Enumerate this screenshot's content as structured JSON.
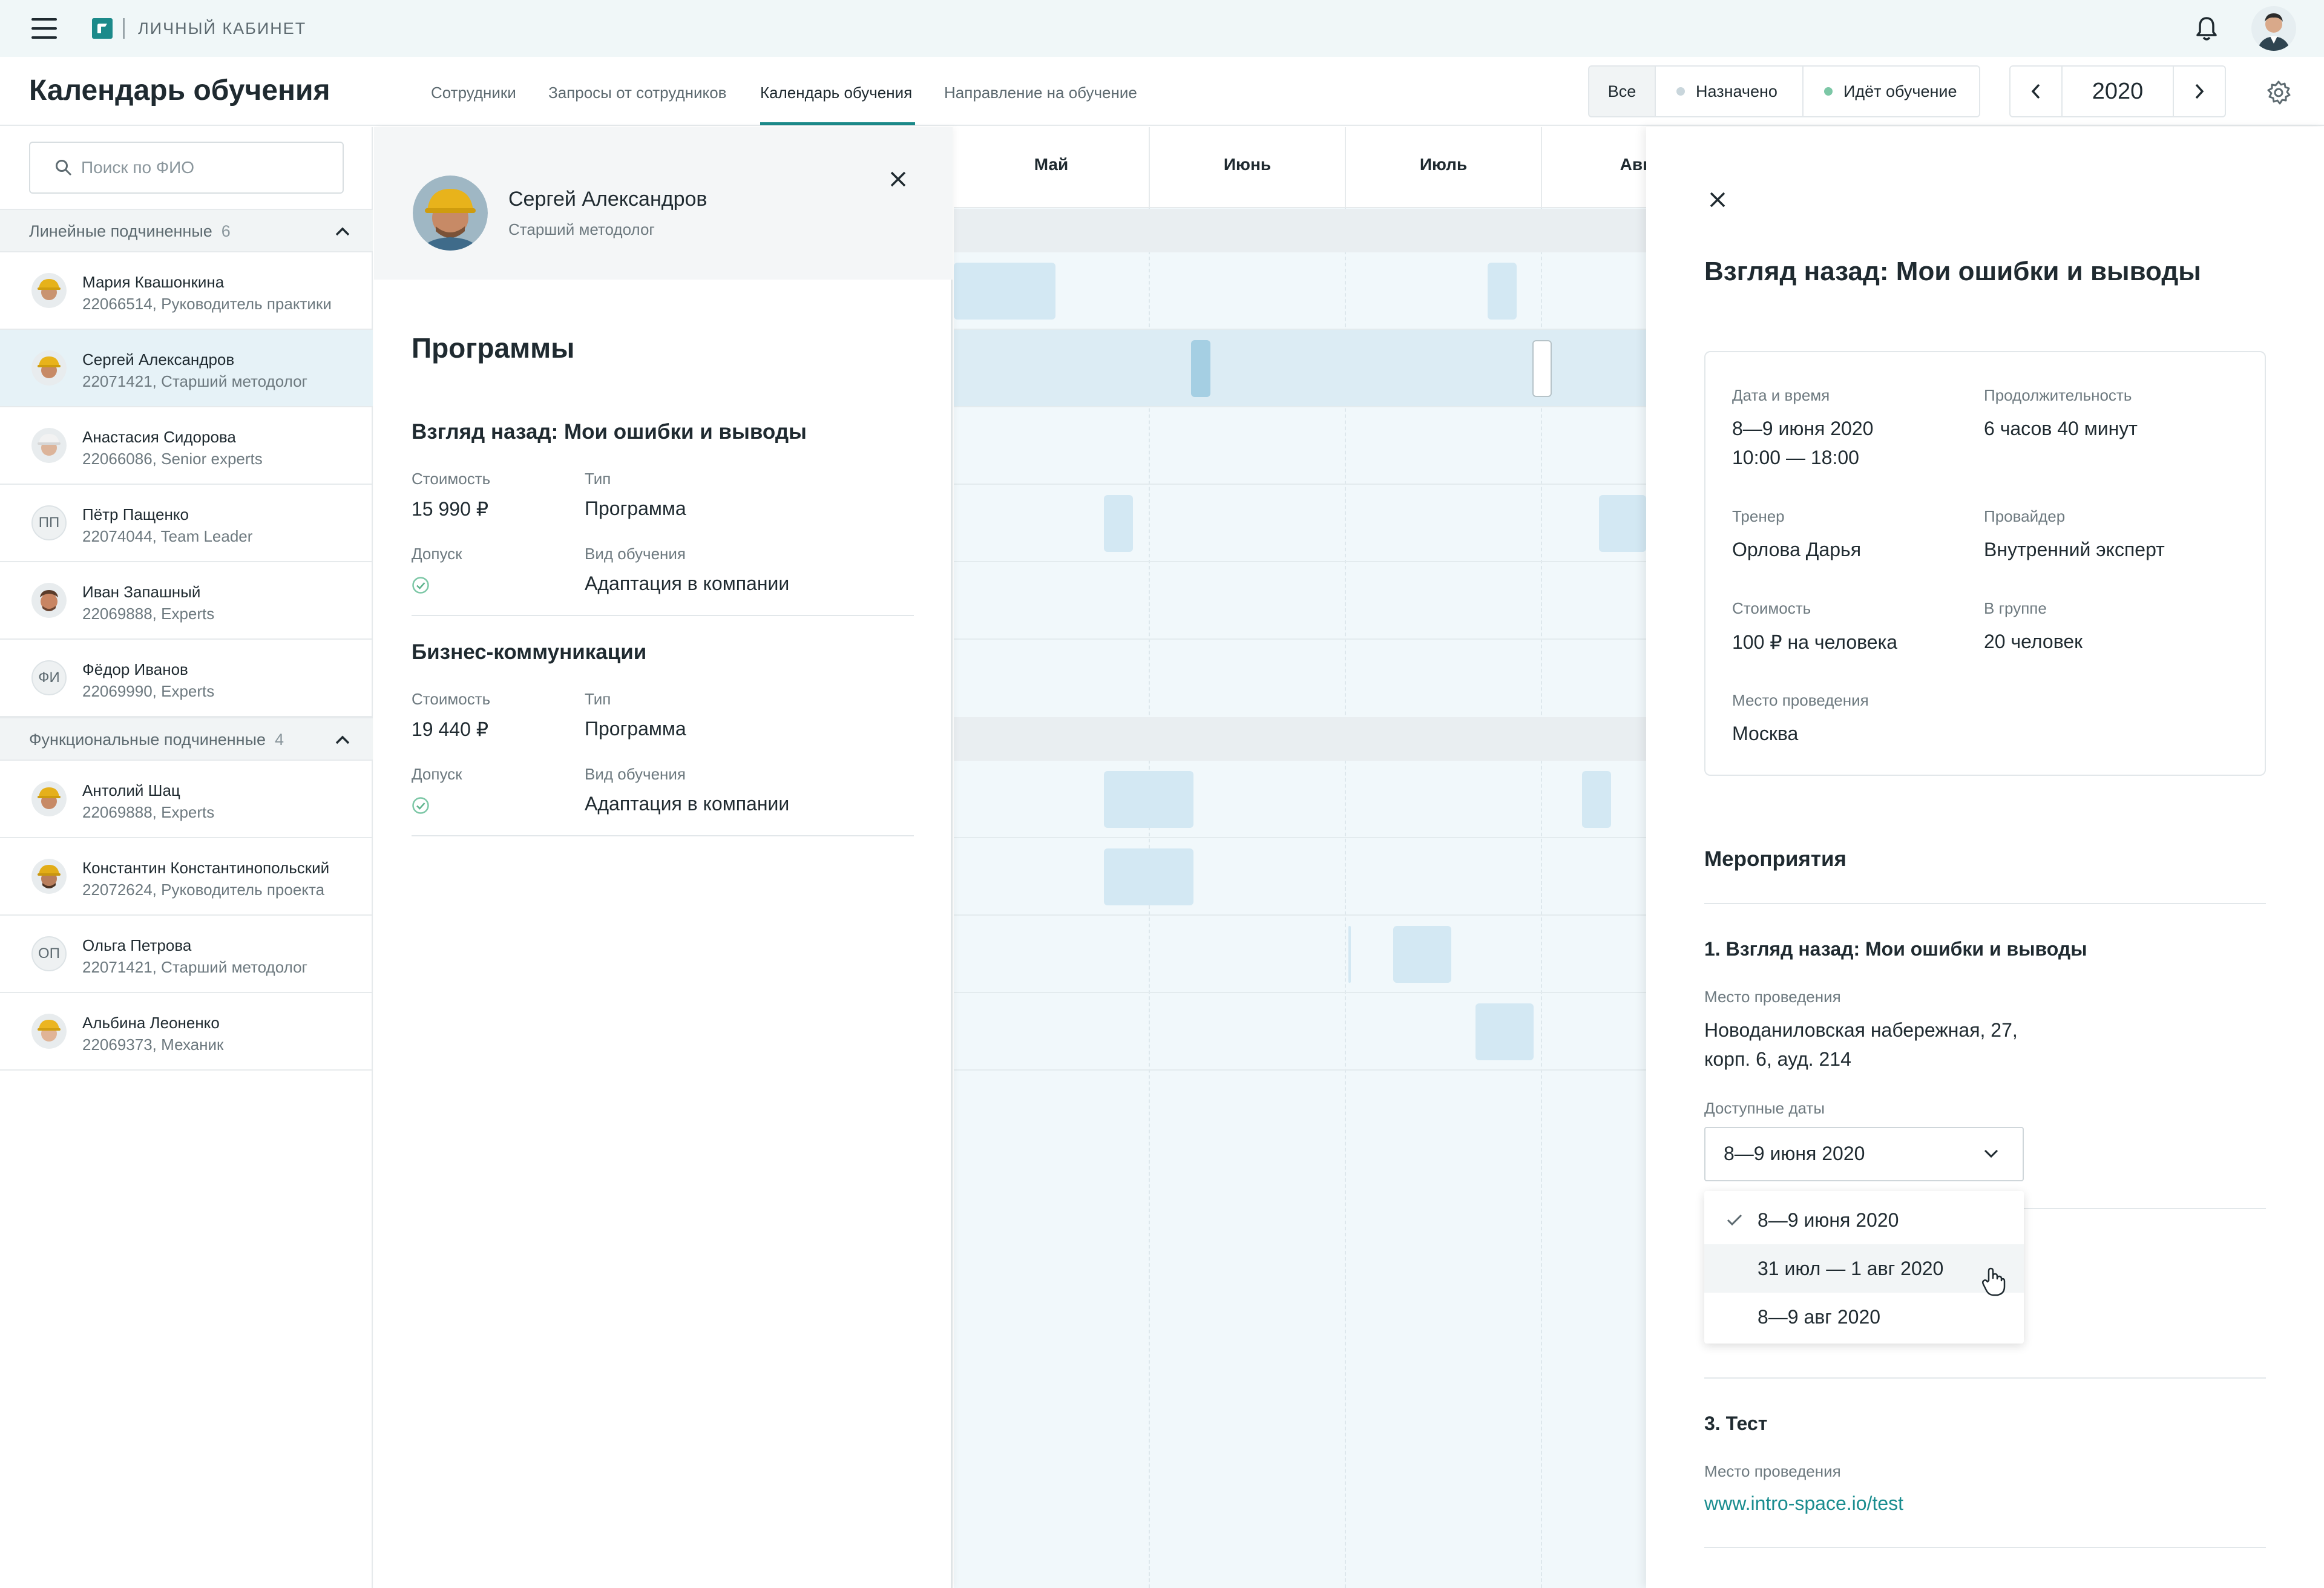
{
  "app": {
    "cabinet_label": "ЛИЧНЫЙ КАБИНЕТ",
    "page_title": "Календарь обучения",
    "accent_color": "#1c8a8a"
  },
  "tabs": [
    {
      "label": "Сотрудники",
      "active": false
    },
    {
      "label": "Запросы от сотрудников",
      "active": false
    },
    {
      "label": "Календарь обучения",
      "active": true
    },
    {
      "label": "Направление на обучение",
      "active": false
    }
  ],
  "filters": {
    "all": "Все",
    "assigned": "Назначено",
    "assigned_color": "#c9d6dc",
    "learning": "Идёт обучение",
    "learning_color": "#7cc7a6"
  },
  "year": {
    "value": "2020"
  },
  "search": {
    "placeholder": "Поиск по ФИО"
  },
  "groups": [
    {
      "label": "Линейные подчиненные",
      "count": "6",
      "people": [
        {
          "name": "Мария Квашонкина",
          "sub": "22066514, Руководитель практики",
          "initials": "",
          "selected": false
        },
        {
          "name": "Сергей Александров",
          "sub": "22071421, Старший методолог",
          "initials": "",
          "selected": true
        },
        {
          "name": "Анастасия Сидорова",
          "sub": "22066086, Senior experts",
          "initials": "",
          "selected": false
        },
        {
          "name": "Пётр Пащенко",
          "sub": "22074044, Team Leader",
          "initials": "ПП",
          "selected": false
        },
        {
          "name": "Иван Запашный",
          "sub": "22069888, Experts",
          "initials": "",
          "selected": false
        },
        {
          "name": "Фёдор Иванов",
          "sub": "22069990, Experts",
          "initials": "ФИ",
          "selected": false
        }
      ]
    },
    {
      "label": "Функциональные подчиненные",
      "count": "4",
      "people": [
        {
          "name": "Антолий Шац",
          "sub": "22069888, Experts",
          "initials": "",
          "selected": false
        },
        {
          "name": "Константин Константинопольский",
          "sub": "22072624, Руководитель проекта",
          "initials": "",
          "selected": false
        },
        {
          "name": "Ольга Петрова",
          "sub": "22071421, Старший методолог",
          "initials": "ОП",
          "selected": false
        },
        {
          "name": "Альбина Леоненко",
          "sub": "22069373, Механик",
          "initials": "",
          "selected": false
        }
      ]
    }
  ],
  "program_panel": {
    "person_name": "Сергей Александров",
    "person_role": "Старший методолог",
    "title": "Программы",
    "programs": [
      {
        "title": "Взгляд назад: Мои ошибки и выводы",
        "cost_label": "Стоимость",
        "cost": "15 990 ₽",
        "type_label": "Тип",
        "type": "Программа",
        "access_label": "Допуск",
        "kind_label": "Вид обучения",
        "kind": "Адаптация в компании"
      },
      {
        "title": "Бизнес-коммуникации",
        "cost_label": "Стоимость",
        "cost": "19 440 ₽",
        "type_label": "Тип",
        "type": "Программа",
        "access_label": "Допуск",
        "kind_label": "Вид обучения",
        "kind": "Адаптация в компании"
      }
    ]
  },
  "calendar": {
    "months": [
      "Май",
      "Июнь",
      "Июль",
      "Авгу"
    ]
  },
  "details": {
    "title": "Взгляд назад: Мои ошибки и выводы",
    "date_label": "Дата и время",
    "date_line1": "8—9  июня 2020",
    "date_line2": "10:00 — 18:00",
    "duration_label": "Продолжительность",
    "duration": "6 часов 40 минут",
    "trainer_label": "Тренер",
    "trainer": "Орлова Дарья",
    "provider_label": "Провайдер",
    "provider": "Внутренний эксперт",
    "cost_label": "Стоимость",
    "cost": "100 ₽ на человека",
    "group_label": "В группе",
    "group": "20 человек",
    "place_label": "Место проведения",
    "place": "Москва",
    "events_title": "Мероприятия",
    "event1": {
      "title": "1. Взгляд назад: Мои ошибки и выводы",
      "place_label": "Место проведения",
      "place_line1": "Новоданиловская набережная, 27,",
      "place_line2": "корп. 6, ауд. 214",
      "dates_label": "Доступные даты",
      "dates_selected": "8—9 июня 2020",
      "options": [
        "8—9 июня 2020",
        "31 июл — 1 авг 2020",
        "8—9 авг 2020"
      ]
    },
    "event3": {
      "title": "3. Тест",
      "place_label": "Место проведения",
      "link": "www.intro-space.io/test"
    }
  }
}
